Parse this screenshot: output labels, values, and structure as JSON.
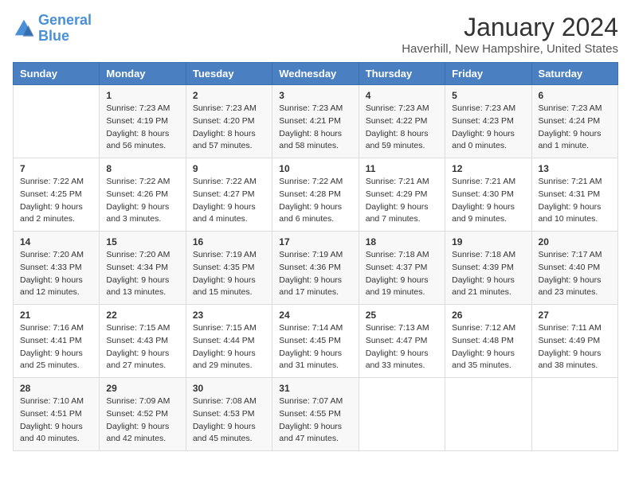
{
  "logo": {
    "line1": "General",
    "line2": "Blue"
  },
  "title": "January 2024",
  "subtitle": "Haverhill, New Hampshire, United States",
  "days_of_week": [
    "Sunday",
    "Monday",
    "Tuesday",
    "Wednesday",
    "Thursday",
    "Friday",
    "Saturday"
  ],
  "weeks": [
    [
      {
        "day": "",
        "sunrise": "",
        "sunset": "",
        "daylight": ""
      },
      {
        "day": "1",
        "sunrise": "Sunrise: 7:23 AM",
        "sunset": "Sunset: 4:19 PM",
        "daylight": "Daylight: 8 hours and 56 minutes."
      },
      {
        "day": "2",
        "sunrise": "Sunrise: 7:23 AM",
        "sunset": "Sunset: 4:20 PM",
        "daylight": "Daylight: 8 hours and 57 minutes."
      },
      {
        "day": "3",
        "sunrise": "Sunrise: 7:23 AM",
        "sunset": "Sunset: 4:21 PM",
        "daylight": "Daylight: 8 hours and 58 minutes."
      },
      {
        "day": "4",
        "sunrise": "Sunrise: 7:23 AM",
        "sunset": "Sunset: 4:22 PM",
        "daylight": "Daylight: 8 hours and 59 minutes."
      },
      {
        "day": "5",
        "sunrise": "Sunrise: 7:23 AM",
        "sunset": "Sunset: 4:23 PM",
        "daylight": "Daylight: 9 hours and 0 minutes."
      },
      {
        "day": "6",
        "sunrise": "Sunrise: 7:23 AM",
        "sunset": "Sunset: 4:24 PM",
        "daylight": "Daylight: 9 hours and 1 minute."
      }
    ],
    [
      {
        "day": "7",
        "sunrise": "Sunrise: 7:22 AM",
        "sunset": "Sunset: 4:25 PM",
        "daylight": "Daylight: 9 hours and 2 minutes."
      },
      {
        "day": "8",
        "sunrise": "Sunrise: 7:22 AM",
        "sunset": "Sunset: 4:26 PM",
        "daylight": "Daylight: 9 hours and 3 minutes."
      },
      {
        "day": "9",
        "sunrise": "Sunrise: 7:22 AM",
        "sunset": "Sunset: 4:27 PM",
        "daylight": "Daylight: 9 hours and 4 minutes."
      },
      {
        "day": "10",
        "sunrise": "Sunrise: 7:22 AM",
        "sunset": "Sunset: 4:28 PM",
        "daylight": "Daylight: 9 hours and 6 minutes."
      },
      {
        "day": "11",
        "sunrise": "Sunrise: 7:21 AM",
        "sunset": "Sunset: 4:29 PM",
        "daylight": "Daylight: 9 hours and 7 minutes."
      },
      {
        "day": "12",
        "sunrise": "Sunrise: 7:21 AM",
        "sunset": "Sunset: 4:30 PM",
        "daylight": "Daylight: 9 hours and 9 minutes."
      },
      {
        "day": "13",
        "sunrise": "Sunrise: 7:21 AM",
        "sunset": "Sunset: 4:31 PM",
        "daylight": "Daylight: 9 hours and 10 minutes."
      }
    ],
    [
      {
        "day": "14",
        "sunrise": "Sunrise: 7:20 AM",
        "sunset": "Sunset: 4:33 PM",
        "daylight": "Daylight: 9 hours and 12 minutes."
      },
      {
        "day": "15",
        "sunrise": "Sunrise: 7:20 AM",
        "sunset": "Sunset: 4:34 PM",
        "daylight": "Daylight: 9 hours and 13 minutes."
      },
      {
        "day": "16",
        "sunrise": "Sunrise: 7:19 AM",
        "sunset": "Sunset: 4:35 PM",
        "daylight": "Daylight: 9 hours and 15 minutes."
      },
      {
        "day": "17",
        "sunrise": "Sunrise: 7:19 AM",
        "sunset": "Sunset: 4:36 PM",
        "daylight": "Daylight: 9 hours and 17 minutes."
      },
      {
        "day": "18",
        "sunrise": "Sunrise: 7:18 AM",
        "sunset": "Sunset: 4:37 PM",
        "daylight": "Daylight: 9 hours and 19 minutes."
      },
      {
        "day": "19",
        "sunrise": "Sunrise: 7:18 AM",
        "sunset": "Sunset: 4:39 PM",
        "daylight": "Daylight: 9 hours and 21 minutes."
      },
      {
        "day": "20",
        "sunrise": "Sunrise: 7:17 AM",
        "sunset": "Sunset: 4:40 PM",
        "daylight": "Daylight: 9 hours and 23 minutes."
      }
    ],
    [
      {
        "day": "21",
        "sunrise": "Sunrise: 7:16 AM",
        "sunset": "Sunset: 4:41 PM",
        "daylight": "Daylight: 9 hours and 25 minutes."
      },
      {
        "day": "22",
        "sunrise": "Sunrise: 7:15 AM",
        "sunset": "Sunset: 4:43 PM",
        "daylight": "Daylight: 9 hours and 27 minutes."
      },
      {
        "day": "23",
        "sunrise": "Sunrise: 7:15 AM",
        "sunset": "Sunset: 4:44 PM",
        "daylight": "Daylight: 9 hours and 29 minutes."
      },
      {
        "day": "24",
        "sunrise": "Sunrise: 7:14 AM",
        "sunset": "Sunset: 4:45 PM",
        "daylight": "Daylight: 9 hours and 31 minutes."
      },
      {
        "day": "25",
        "sunrise": "Sunrise: 7:13 AM",
        "sunset": "Sunset: 4:47 PM",
        "daylight": "Daylight: 9 hours and 33 minutes."
      },
      {
        "day": "26",
        "sunrise": "Sunrise: 7:12 AM",
        "sunset": "Sunset: 4:48 PM",
        "daylight": "Daylight: 9 hours and 35 minutes."
      },
      {
        "day": "27",
        "sunrise": "Sunrise: 7:11 AM",
        "sunset": "Sunset: 4:49 PM",
        "daylight": "Daylight: 9 hours and 38 minutes."
      }
    ],
    [
      {
        "day": "28",
        "sunrise": "Sunrise: 7:10 AM",
        "sunset": "Sunset: 4:51 PM",
        "daylight": "Daylight: 9 hours and 40 minutes."
      },
      {
        "day": "29",
        "sunrise": "Sunrise: 7:09 AM",
        "sunset": "Sunset: 4:52 PM",
        "daylight": "Daylight: 9 hours and 42 minutes."
      },
      {
        "day": "30",
        "sunrise": "Sunrise: 7:08 AM",
        "sunset": "Sunset: 4:53 PM",
        "daylight": "Daylight: 9 hours and 45 minutes."
      },
      {
        "day": "31",
        "sunrise": "Sunrise: 7:07 AM",
        "sunset": "Sunset: 4:55 PM",
        "daylight": "Daylight: 9 hours and 47 minutes."
      },
      {
        "day": "",
        "sunrise": "",
        "sunset": "",
        "daylight": ""
      },
      {
        "day": "",
        "sunrise": "",
        "sunset": "",
        "daylight": ""
      },
      {
        "day": "",
        "sunrise": "",
        "sunset": "",
        "daylight": ""
      }
    ]
  ]
}
